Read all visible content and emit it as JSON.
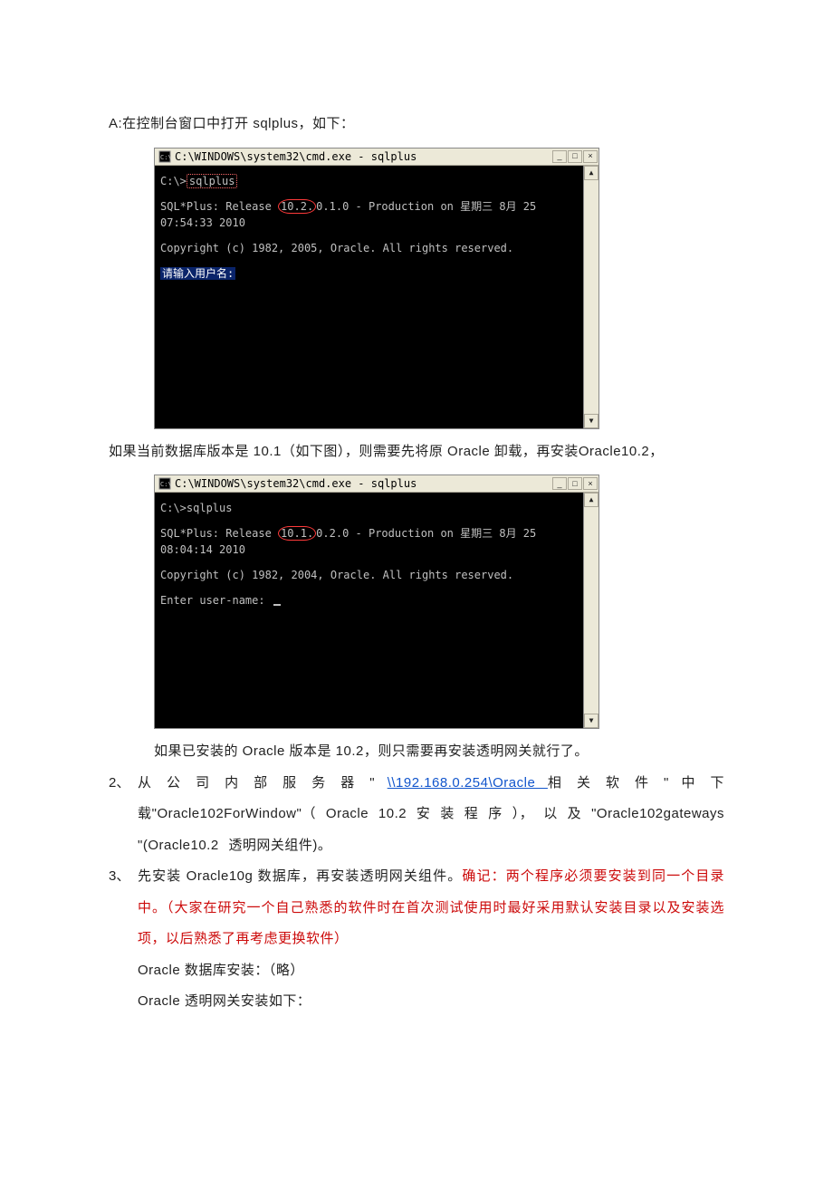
{
  "intro": "A:在控制台窗口中打开 sqlplus，如下：",
  "terminal1": {
    "title": "C:\\WINDOWS\\system32\\cmd.exe - sqlplus",
    "prompt_prefix": "C:\\>",
    "prompt_cmd": "sqlplus",
    "release_pre": "SQL*Plus: Release ",
    "release_ver": "10.2.",
    "release_post": "0.1.0 - Production on 星期三 8月 25 07:54:33 2010",
    "copyright": "Copyright (c) 1982, 2005, Oracle.  All rights reserved.",
    "user_prompt": "请输入用户名:"
  },
  "after_t1": "如果当前数据库版本是 10.1（如下图），则需要先将原 Oracle 卸载，再安装Oracle10.2，",
  "terminal2": {
    "title": "C:\\WINDOWS\\system32\\cmd.exe - sqlplus",
    "prompt_prefix": "C:\\>",
    "prompt_cmd": "sqlplus",
    "release_pre": "SQL*Plus: Release ",
    "release_ver": "10.1.",
    "release_post": "0.2.0 - Production on 星期三 8月 25 08:04:14 2010",
    "copyright": "Copyright (c) 1982, 2004, Oracle.  All rights reserved.",
    "user_prompt": "Enter user-name: "
  },
  "caption2": "如果已安装的 Oracle 版本是 10.2，则只需要再安装透明网关就行了。",
  "item2": {
    "marker": "2、",
    "p1_a": "从 公 司 内 部 服 务 器 \" ",
    "link": "\\\\192.168.0.254\\Oracle ",
    "p1_b": "相 关 软 件 \" 中 下 载\"Oracle102ForWindow\"（ Oracle 10.2 安 装 程 序 ）， 以 及 \"Oracle102gateways \"(Oracle10.2 透明网关组件)。"
  },
  "item3": {
    "marker": "3、",
    "p1_a": "先安装 Oracle10g 数据库，再安装透明网关组件。",
    "p1_red": "确记：两个程序必须要安装到同一个目录中。（大家在研究一个自己熟悉的软件时在首次测试使用时最好采用默认安装目录以及安装选项，以后熟悉了再考虑更换软件）",
    "p2": "Oracle 数据库安装：（略）",
    "p3": "Oracle 透明网关安装如下："
  },
  "icons": {
    "min": "_",
    "max": "□",
    "close": "×",
    "up": "▲",
    "down": "▼",
    "cmd": "C:\\"
  }
}
